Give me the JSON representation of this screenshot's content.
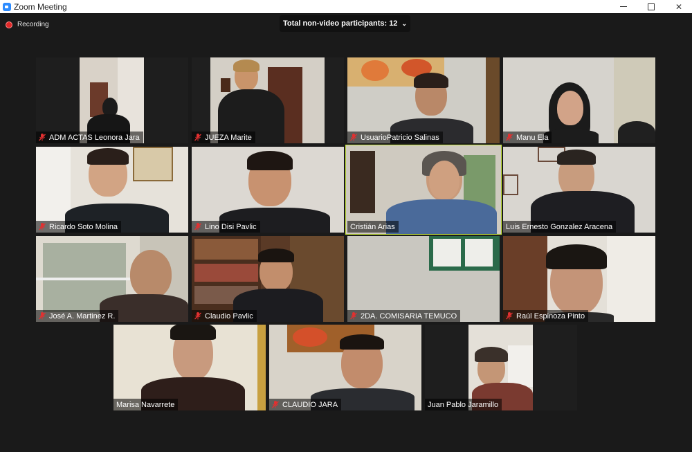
{
  "window": {
    "title": "Zoom Meeting"
  },
  "recording": {
    "label": "Recording"
  },
  "participants_bar": {
    "label": "Total non-video participants: 12"
  },
  "colors": {
    "active_speaker": "#c8e83c",
    "muted_mic": "#e23030",
    "recording": "#e02828"
  },
  "tiles": [
    {
      "name": "ADM ACTAS Leonora Jara",
      "muted": true
    },
    {
      "name": "JUEZA Marite",
      "muted": true
    },
    {
      "name": "UsuarioPatricio Salinas",
      "muted": true
    },
    {
      "name": "Manu Ela",
      "muted": true
    },
    {
      "name": "Ricardo Soto Molina",
      "muted": true
    },
    {
      "name": "Lino Disi Pavlic",
      "muted": true
    },
    {
      "name": "Cristián Arias",
      "muted": false,
      "active": true
    },
    {
      "name": "Luis Ernesto Gonzalez Aracena",
      "muted": false
    },
    {
      "name": "José A. Martinez R.",
      "muted": true
    },
    {
      "name": "Claudio Pavlic",
      "muted": true
    },
    {
      "name": "2DA. COMISARIA TEMUCO",
      "muted": true
    },
    {
      "name": "Raúl Espinoza Pinto",
      "muted": true
    },
    {
      "name": "Marisa Navarrete",
      "muted": false
    },
    {
      "name": "CLAUDIO JARA",
      "muted": true
    },
    {
      "name": "Juan Pablo Jaramillo",
      "muted": false
    }
  ]
}
